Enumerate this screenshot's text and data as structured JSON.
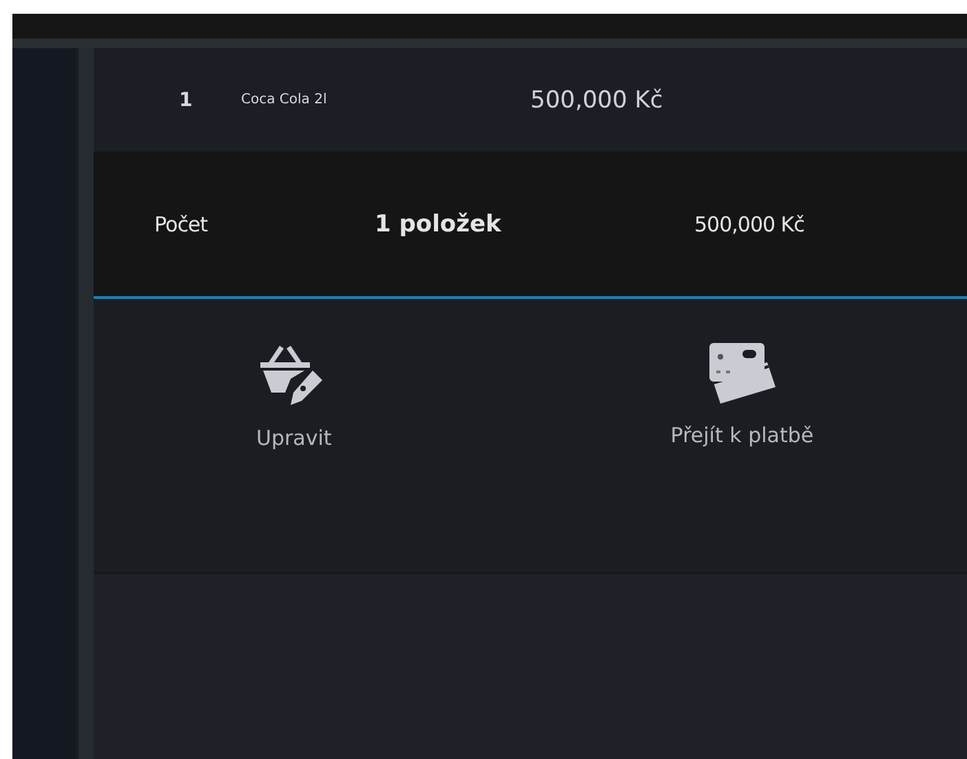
{
  "items": [
    {
      "quantity": "1",
      "name": "Coca Cola 2l",
      "price": "500,000 Kč"
    }
  ],
  "summary": {
    "label": "Počet",
    "count": "1 položek",
    "total": "500,000 Kč"
  },
  "actions": [
    {
      "kind": "edit",
      "label": "Upravit"
    },
    {
      "kind": "pay",
      "label": "Přejít k platbě"
    }
  ]
}
